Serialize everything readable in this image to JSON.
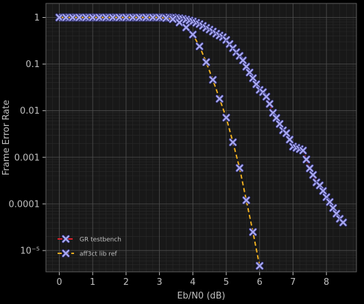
{
  "colors": {
    "background": "#000000",
    "plot_background": "#181818",
    "grid_major": "#505050",
    "grid_minor": "#2a2a2a",
    "text": "#c0c0c0",
    "marker_fill": "#a8a8f0",
    "marker_stroke": "#2a2a6a",
    "gr_line": "#e0202a",
    "aff_line": "#f0b020"
  },
  "chart_data": {
    "type": "scatter",
    "title": "",
    "xlabel": "Eb/N0 (dB)",
    "ylabel": "Frame Error Rate",
    "xlim": [
      -0.4,
      8.9
    ],
    "ylim": [
      3.5e-06,
      2.0
    ],
    "yscale": "log",
    "grid": true,
    "legend_position": "bottom-left",
    "x_ticks": [
      0,
      1,
      2,
      3,
      4,
      5,
      6,
      7,
      8
    ],
    "x_tick_labels": [
      "0",
      "1",
      "2",
      "3",
      "4",
      "5",
      "6",
      "7",
      "8"
    ],
    "y_ticks": [
      1,
      0.1,
      0.01,
      0.001,
      0.0001,
      1e-05
    ],
    "y_tick_labels": [
      "1",
      "0.1",
      "0.01",
      "0.001",
      "0.0001",
      "10⁻⁵"
    ],
    "series": [
      {
        "name": "GR testbench",
        "line_style": "dashdot",
        "color": "#e0202a",
        "x": [
          0.0,
          0.1,
          0.2,
          0.3,
          0.4,
          0.5,
          0.6,
          0.7,
          0.8,
          0.9,
          1.0,
          1.1,
          1.2,
          1.3,
          1.4,
          1.5,
          1.6,
          1.7,
          1.8,
          1.9,
          2.0,
          2.1,
          2.2,
          2.3,
          2.4,
          2.5,
          2.6,
          2.7,
          2.8,
          2.9,
          3.0,
          3.1,
          3.2,
          3.3,
          3.4,
          3.5,
          3.6,
          3.7,
          3.8,
          3.9,
          4.0,
          4.1,
          4.2,
          4.3,
          4.4,
          4.5,
          4.6,
          4.7,
          4.8,
          4.9,
          5.0,
          5.1,
          5.2,
          5.3,
          5.4,
          5.5,
          5.6,
          5.7,
          5.8,
          5.9,
          6.0,
          6.1,
          6.2,
          6.3,
          6.4,
          6.5,
          6.6,
          6.7,
          6.8,
          6.9,
          7.0,
          7.1,
          7.2,
          7.3,
          7.4,
          7.5,
          7.6,
          7.7,
          7.8,
          7.9,
          8.0,
          8.1,
          8.2,
          8.3,
          8.4,
          8.5
        ],
        "y": [
          1.0,
          1.0,
          1.0,
          1.0,
          1.0,
          1.0,
          1.0,
          1.0,
          1.0,
          1.0,
          1.0,
          1.0,
          1.0,
          1.0,
          1.0,
          1.0,
          1.0,
          1.0,
          1.0,
          1.0,
          1.0,
          1.0,
          1.0,
          1.0,
          1.0,
          1.0,
          1.0,
          1.0,
          1.0,
          1.0,
          1.0,
          1.0,
          1.0,
          1.0,
          1.0,
          0.98,
          0.96,
          0.93,
          0.9,
          0.86,
          0.82,
          0.77,
          0.72,
          0.66,
          0.6,
          0.55,
          0.5,
          0.45,
          0.41,
          0.38,
          0.33,
          0.27,
          0.22,
          0.18,
          0.15,
          0.12,
          0.088,
          0.066,
          0.05,
          0.037,
          0.028,
          0.025,
          0.02,
          0.014,
          0.009,
          0.007,
          0.0052,
          0.0038,
          0.0033,
          0.0024,
          0.0017,
          0.0016,
          0.0015,
          0.0014,
          0.0009,
          0.00058,
          0.00042,
          0.00029,
          0.00025,
          0.00019,
          0.00014,
          0.00011,
          8.2e-05,
          6.2e-05,
          4.8e-05,
          4e-05
        ]
      },
      {
        "name": "aff3ct lib ref",
        "line_style": "dashed",
        "color": "#f0b020",
        "x": [
          0.0,
          0.2,
          0.4,
          0.6,
          0.8,
          1.0,
          1.2,
          1.4,
          1.6,
          1.8,
          2.0,
          2.2,
          2.4,
          2.6,
          2.8,
          3.0,
          3.2,
          3.4,
          3.6,
          3.8,
          4.0,
          4.2,
          4.4,
          4.6,
          4.8,
          5.0,
          5.2,
          5.4,
          5.6,
          5.8,
          6.0
        ],
        "y": [
          1.0,
          1.0,
          1.0,
          1.0,
          1.0,
          1.0,
          1.0,
          1.0,
          1.0,
          1.0,
          1.0,
          1.0,
          1.0,
          1.0,
          1.0,
          1.0,
          0.97,
          0.92,
          0.78,
          0.61,
          0.43,
          0.24,
          0.11,
          0.046,
          0.018,
          0.0071,
          0.0021,
          0.00059,
          0.00012,
          2.5e-05,
          4.7e-06
        ]
      }
    ]
  }
}
